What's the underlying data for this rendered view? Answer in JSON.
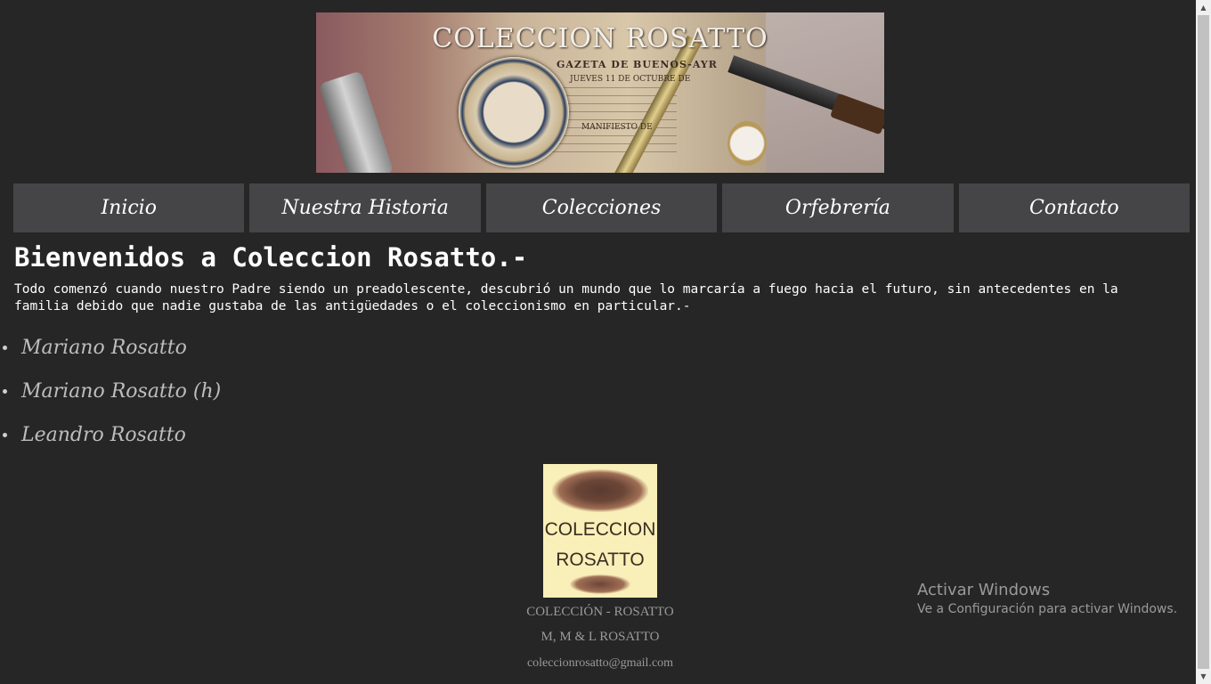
{
  "banner": {
    "title": "COLECCION ROSATTO",
    "subtitle": "GAZETA DE BUENOS-AYR",
    "date": "JUEVES 11 DE OCTUBRE DE",
    "manifiesto": "MANIFIESTO DE"
  },
  "nav": {
    "items": [
      {
        "label": "Inicio"
      },
      {
        "label": "Nuestra Historia"
      },
      {
        "label": "Colecciones"
      },
      {
        "label": "Orfebrería"
      },
      {
        "label": "Contacto"
      }
    ]
  },
  "main": {
    "heading": "Bienvenidos a Coleccion Rosatto.-",
    "intro": "Todo comenzó cuando nuestro Padre siendo un preadolescente, descubrió un mundo que lo marcaría a fuego hacia el futuro, sin antecedentes en la familia debido que nadie gustaba de las antigüedades o el coleccionismo en particular.-",
    "members": [
      {
        "name": "Mariano Rosatto"
      },
      {
        "name": "Mariano Rosatto (h)"
      },
      {
        "name": "Leandro Rosatto"
      }
    ]
  },
  "footer": {
    "logo_line1": "COLECCION",
    "logo_line2": "ROSATTO",
    "line1": "COLECCIÓN - ROSATTO",
    "line2": "M, M & L ROSATTO",
    "email": "coleccionrosatto@gmail.com"
  },
  "watermark": {
    "title": "Activar Windows",
    "subtitle": "Ve a Configuración para activar Windows."
  },
  "scrollbar": {
    "up_icon": "▲",
    "down_icon": "▼"
  },
  "colors": {
    "background": "#262626",
    "nav_button": "#454547",
    "text": "#ffffff",
    "muted_text": "#9a9a9a",
    "logo_background": "#f9efb8"
  }
}
